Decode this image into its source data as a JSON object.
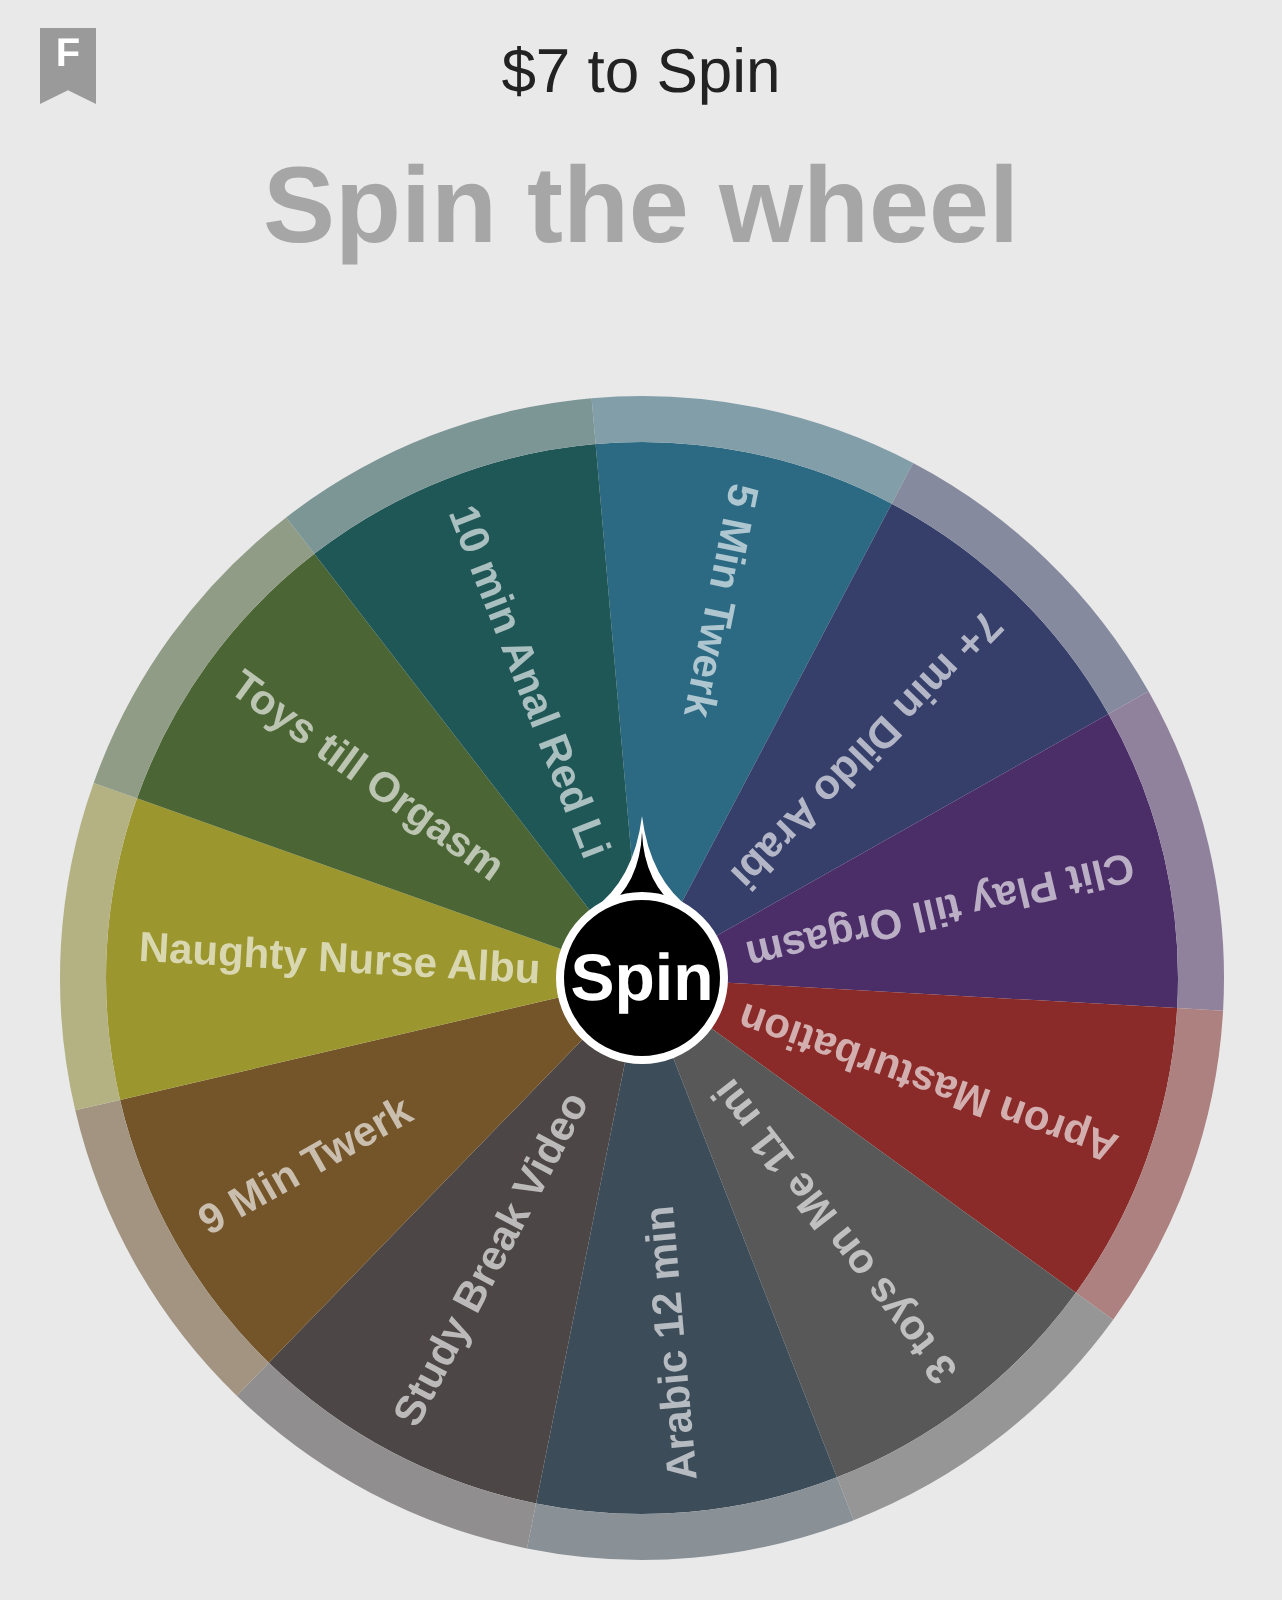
{
  "header": {
    "logo_letter": "F",
    "price_label": "$7 to Spin"
  },
  "title": "Spin the wheel",
  "wheel": {
    "segments": [
      {
        "label": "5 Min Twerk",
        "color": "#2b6a82"
      },
      {
        "label": "7+ min Dildo Arabi",
        "color": "#363f6a"
      },
      {
        "label": "Clit Play till Orgasm",
        "color": "#4b2d68"
      },
      {
        "label": "Apron Masturbation",
        "color": "#8a2b29"
      },
      {
        "label": "3 toys on Me 11 mi",
        "color": "#585858"
      },
      {
        "label": "Arabic 12 min",
        "color": "#3c4c58"
      },
      {
        "label": "Study Break Video",
        "color": "#4c4646"
      },
      {
        "label": "9 Min Twerk",
        "color": "#74552a"
      },
      {
        "label": "Naughty Nurse Albu",
        "color": "#9c962e"
      },
      {
        "label": "Toys till Orgasm",
        "color": "#4b6634"
      },
      {
        "label": "10 min Anal Red Li",
        "color": "#1f5656"
      }
    ]
  },
  "spin_button": {
    "label": "Spin"
  }
}
